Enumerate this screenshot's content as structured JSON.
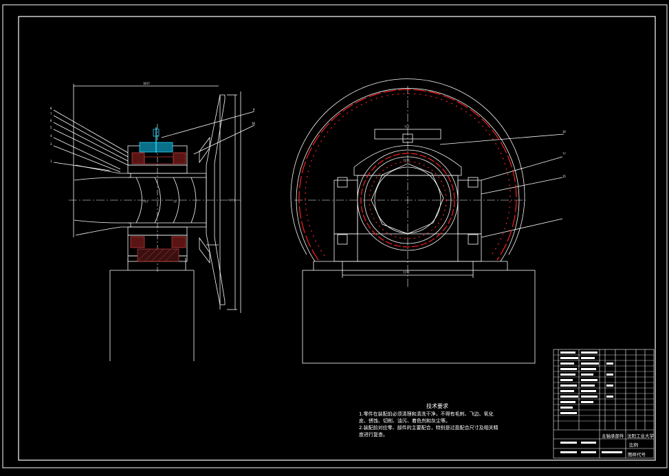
{
  "dimensions": {
    "overall_length": "1817",
    "rear_height": "????",
    "shaft_dia": "??",
    "bore_dia": "???",
    "front_top": "???",
    "front_bearing_span": "????",
    "front_base_width": "????"
  },
  "left_view_callouts": [
    "8",
    "7",
    "6",
    "5",
    "4",
    "3",
    "1",
    "9",
    "10"
  ],
  "right_view_callouts": [
    "14",
    "??",
    "15"
  ],
  "technical_requirements": {
    "title": "技术要求",
    "lines": [
      "1.零件在装配前必须清理和清洗干净，不得有毛刺、飞边、氧化",
      "皮、锈蚀、切削、油污、着色剂和灰尘等。",
      "2.装配前对应零、部件的主要配合，特别是过盈配合尺寸及相关精",
      "度进行复查。"
    ]
  },
  "title_block": {
    "drawing_name": "主轴承部件",
    "school": "沈阳工业大学",
    "scale_label": "比例",
    "code_label": "图样代号"
  },
  "colors": {
    "background": "#000000",
    "line": "#ffffff",
    "liner": "#ff2020",
    "cyan": "#29d7ff",
    "section": "#d24040"
  }
}
